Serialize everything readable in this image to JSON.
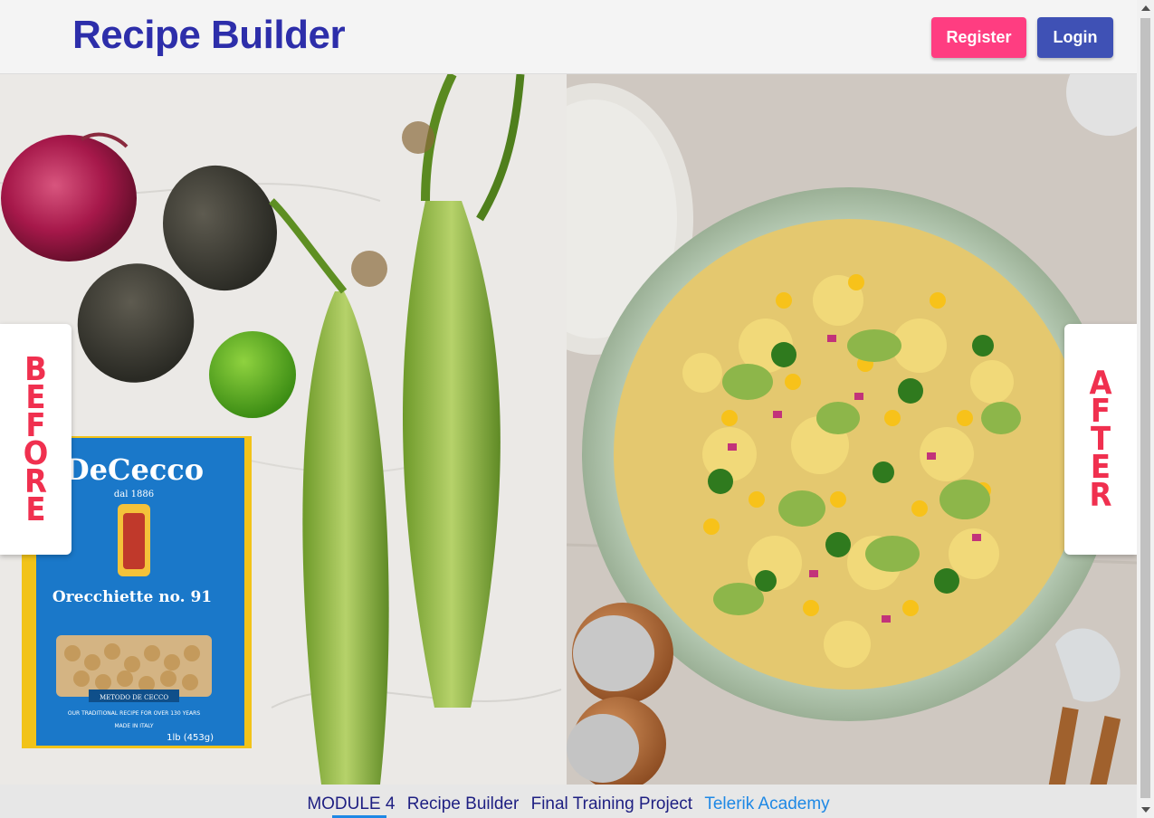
{
  "header": {
    "title": "Recipe Builder",
    "register_label": "Register",
    "login_label": "Login"
  },
  "hero": {
    "before_label": "BEFORE",
    "after_label": "AFTER",
    "package": {
      "brand": "DeCecco",
      "since": "dal 1886",
      "product": "Orecchiette no. 91",
      "badge": "METODO DE CECCO",
      "tagline": "OUR TRADITIONAL RECIPE FOR OVER 130 YEARS",
      "origin": "MADE IN ITALY",
      "weight": "1lb (453g)"
    }
  },
  "footer": {
    "module": "MODULE 4",
    "app": "Recipe Builder",
    "project": "Final Training Project",
    "academy": "Telerik Academy"
  },
  "colors": {
    "title": "#2d2eaa",
    "register": "#ff3d81",
    "login": "#3f51b5",
    "side_label_text": "#f0304f",
    "footer_link": "#1e88e5"
  }
}
